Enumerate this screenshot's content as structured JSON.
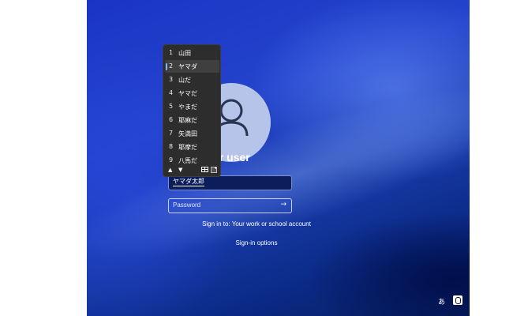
{
  "login": {
    "username_visible": "er user",
    "name_field_value": "ヤマダ太郎",
    "password_placeholder": "Password",
    "submit_arrow": "→",
    "sign_in_to": "Sign in to: Your work or school account",
    "sign_in_options": "Sign-in options"
  },
  "ime": {
    "candidates": [
      {
        "num": "1",
        "text": "山田"
      },
      {
        "num": "2",
        "text": "ヤマダ"
      },
      {
        "num": "3",
        "text": "山だ"
      },
      {
        "num": "4",
        "text": "ヤマだ"
      },
      {
        "num": "5",
        "text": "やまだ"
      },
      {
        "num": "6",
        "text": "耶麻だ"
      },
      {
        "num": "7",
        "text": "矢満田"
      },
      {
        "num": "8",
        "text": "耶摩だ"
      },
      {
        "num": "9",
        "text": "八馬だ"
      }
    ],
    "selected_index": 1,
    "up_label": "▲",
    "down_label": "▼",
    "mode_indicator": "あ"
  },
  "icons": {
    "avatar": "user-avatar-icon",
    "table_view": "table-view-icon",
    "expand": "expand-icon",
    "accessibility": "accessibility-icon"
  },
  "colors": {
    "background_blue": "#1a35c6",
    "avatar_fill": "#b6c4ea",
    "ime_background": "#2d2d2d",
    "selection_accent": "#7fb2ff"
  }
}
